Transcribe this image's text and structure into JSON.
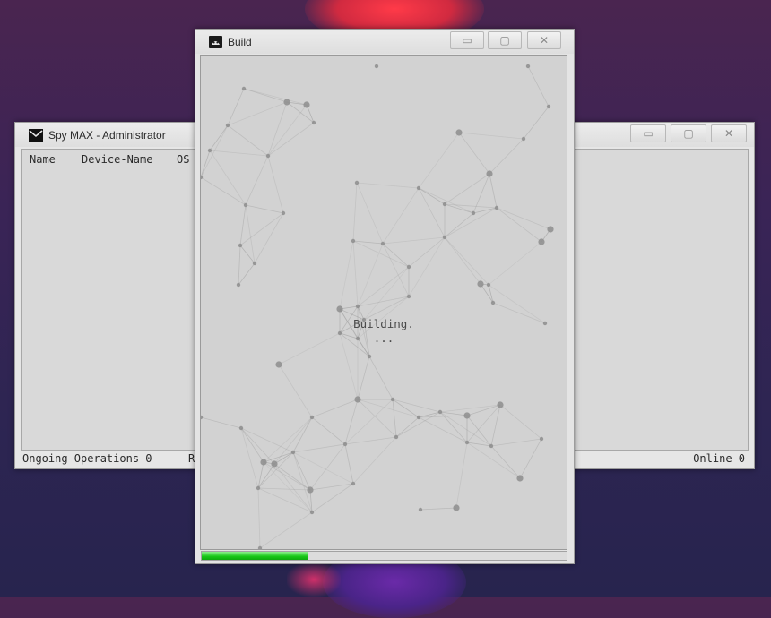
{
  "main_window": {
    "title": "Spy MAX - Administrator",
    "columns": [
      "Name",
      "Device-Name",
      "OS"
    ],
    "status_left": "Ongoing Operations 0",
    "status_left_trunc": "R",
    "status_right": "Online 0"
  },
  "build_window": {
    "title": "Build",
    "status_line1": "Building.",
    "status_line2": "...",
    "progress": 0.29
  },
  "controls": {
    "minimize": "▭",
    "maximize": "▢",
    "close": "✕"
  },
  "icons": {
    "main_app": "envelope-icon",
    "build_app": "android-icon"
  },
  "colors": {
    "progress_fill": "#16c616"
  }
}
